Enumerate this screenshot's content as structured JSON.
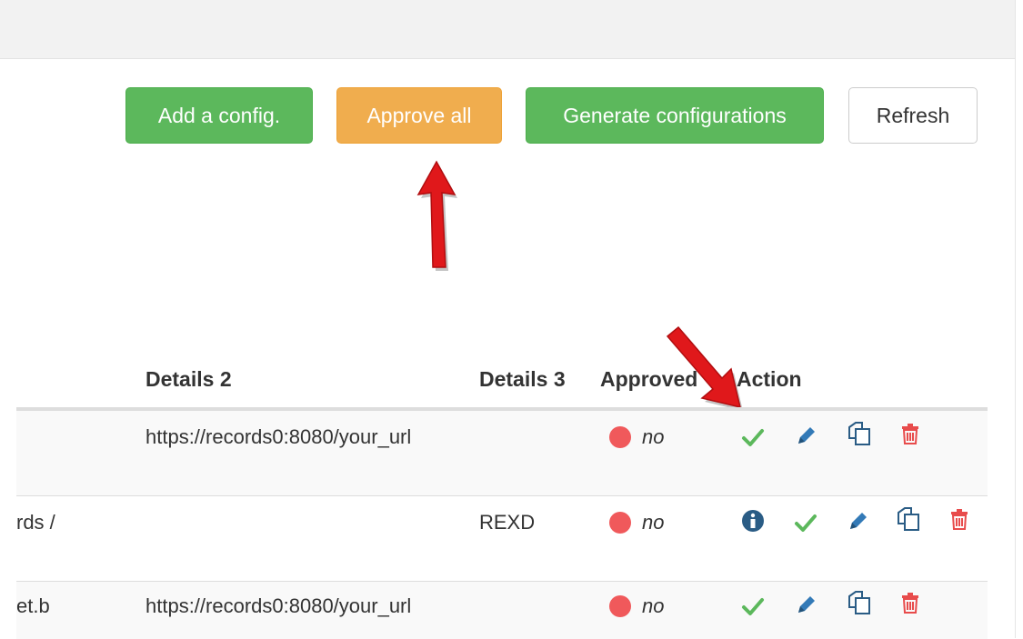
{
  "toolbar": {
    "add_label": "Add a config.",
    "approve_label": "Approve all",
    "generate_label": "Generate configurations",
    "refresh_label": "Refresh"
  },
  "table": {
    "headers": [
      "Details 2",
      "Details 3",
      "Approved",
      "Action"
    ],
    "rows": [
      {
        "col1": "",
        "details2": "https://records0:8080/your_url",
        "details3": "",
        "approved": "no"
      },
      {
        "col1": "rds /",
        "details2": "",
        "details3": "REXD",
        "approved": "no"
      },
      {
        "col1": "et.b",
        "details2": "https://records0:8080/your_url",
        "details3": "",
        "approved": "no"
      }
    ]
  },
  "colors": {
    "green": "#5cb85c",
    "orange": "#f0ad4e",
    "status_red": "#f0595b",
    "approve_icon": "#5cb85c",
    "edit_icon": "#337ab7",
    "delete_icon": "#e84c4c",
    "arrow": "#e0181b"
  }
}
